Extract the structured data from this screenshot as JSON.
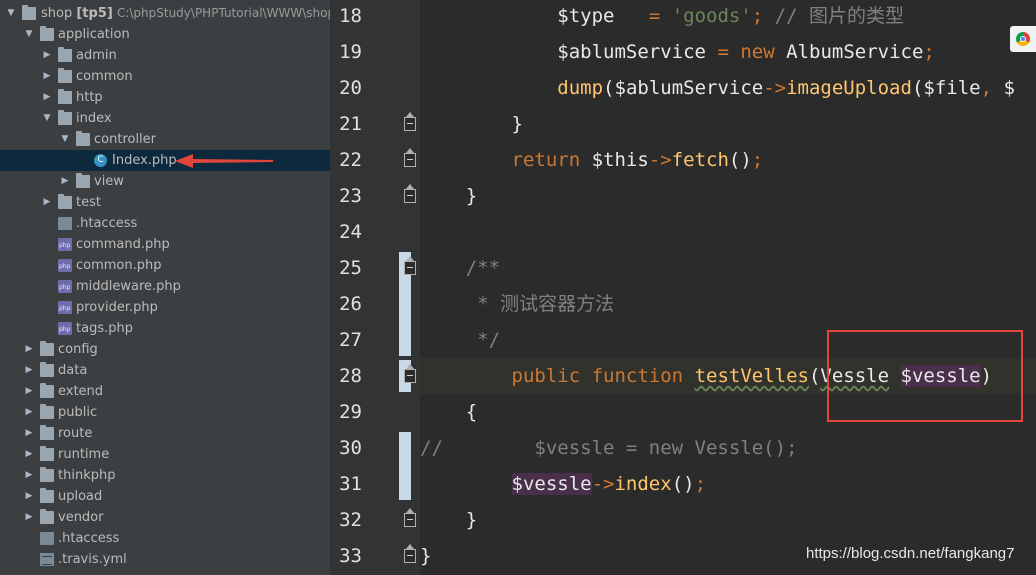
{
  "tree": {
    "root": {
      "name": "shop",
      "module": "[tp5]",
      "path": "C:\\phpStudy\\PHPTutorial\\WWW\\shop"
    },
    "items": [
      {
        "label": "application",
        "type": "folder",
        "indent": 1,
        "expanded": true
      },
      {
        "label": "admin",
        "type": "folder",
        "indent": 2,
        "expanded": false
      },
      {
        "label": "common",
        "type": "folder",
        "indent": 2,
        "expanded": false
      },
      {
        "label": "http",
        "type": "folder",
        "indent": 2,
        "expanded": false
      },
      {
        "label": "index",
        "type": "folder",
        "indent": 2,
        "expanded": true
      },
      {
        "label": "controller",
        "type": "folder",
        "indent": 3,
        "expanded": true
      },
      {
        "label": "Index.php",
        "type": "class",
        "indent": 4,
        "selected": true
      },
      {
        "label": "view",
        "type": "folder",
        "indent": 3,
        "expanded": false
      },
      {
        "label": "test",
        "type": "folder",
        "indent": 2,
        "expanded": false
      },
      {
        "label": ".htaccess",
        "type": "file",
        "indent": 2
      },
      {
        "label": "command.php",
        "type": "php",
        "indent": 2
      },
      {
        "label": "common.php",
        "type": "php",
        "indent": 2
      },
      {
        "label": "middleware.php",
        "type": "php",
        "indent": 2
      },
      {
        "label": "provider.php",
        "type": "php",
        "indent": 2
      },
      {
        "label": "tags.php",
        "type": "php",
        "indent": 2
      },
      {
        "label": "config",
        "type": "folder",
        "indent": 1,
        "expanded": false
      },
      {
        "label": "data",
        "type": "folder",
        "indent": 1,
        "expanded": false
      },
      {
        "label": "extend",
        "type": "folder",
        "indent": 1,
        "expanded": false
      },
      {
        "label": "public",
        "type": "folder",
        "indent": 1,
        "expanded": false
      },
      {
        "label": "route",
        "type": "folder",
        "indent": 1,
        "expanded": false
      },
      {
        "label": "runtime",
        "type": "folder",
        "indent": 1,
        "expanded": false
      },
      {
        "label": "thinkphp",
        "type": "folder",
        "indent": 1,
        "expanded": false
      },
      {
        "label": "upload",
        "type": "folder",
        "indent": 1,
        "expanded": false
      },
      {
        "label": "vendor",
        "type": "folder",
        "indent": 1,
        "expanded": false
      },
      {
        "label": ".htaccess",
        "type": "file",
        "indent": 1
      },
      {
        "label": ".travis.yml",
        "type": "yml",
        "indent": 1
      }
    ]
  },
  "editor": {
    "lines": [
      {
        "num": "18",
        "tokens": [
          [
            "var",
            "            $type"
          ],
          [
            "",
            "   "
          ],
          [
            "kw",
            "="
          ],
          [
            "",
            " "
          ],
          [
            "str",
            "'goods'"
          ],
          [
            "kw",
            ";"
          ],
          [
            "cm",
            " // 图片的类型"
          ]
        ]
      },
      {
        "num": "19",
        "tokens": [
          [
            "var",
            "            $ablumService"
          ],
          [
            "",
            " "
          ],
          [
            "kw",
            "="
          ],
          [
            "",
            " "
          ],
          [
            "kw",
            "new"
          ],
          [
            "",
            " "
          ],
          [
            "cls",
            "AlbumService"
          ],
          [
            "kw",
            ";"
          ]
        ]
      },
      {
        "num": "20",
        "tokens": [
          [
            "",
            "            "
          ],
          [
            "fn",
            "dump"
          ],
          [
            "",
            "("
          ],
          [
            "var",
            "$ablumService"
          ],
          [
            "kw",
            "->"
          ],
          [
            "fn",
            "imageUpload"
          ],
          [
            "",
            "("
          ],
          [
            "var",
            "$file"
          ],
          [
            "kw",
            ","
          ],
          [
            "",
            " $"
          ]
        ]
      },
      {
        "num": "21",
        "tokens": [
          [
            "",
            "        }"
          ]
        ]
      },
      {
        "num": "22",
        "tokens": [
          [
            "",
            "        "
          ],
          [
            "kw",
            "return"
          ],
          [
            "",
            " "
          ],
          [
            "var",
            "$this"
          ],
          [
            "kw",
            "->"
          ],
          [
            "fn",
            "fetch"
          ],
          [
            "",
            "()"
          ],
          [
            "kw",
            ";"
          ]
        ]
      },
      {
        "num": "23",
        "tokens": [
          [
            "",
            "    }"
          ]
        ]
      },
      {
        "num": "24",
        "tokens": []
      },
      {
        "num": "25",
        "tokens": [
          [
            "cm",
            "    /**"
          ]
        ]
      },
      {
        "num": "26",
        "tokens": [
          [
            "cm",
            "     * 测试容器方法"
          ]
        ]
      },
      {
        "num": "27",
        "tokens": [
          [
            "cm",
            "     */"
          ]
        ]
      },
      {
        "num": "28",
        "tokens": [
          [
            "",
            "        "
          ],
          [
            "kw",
            "public"
          ],
          [
            "",
            " "
          ],
          [
            "kw",
            "function"
          ],
          [
            "",
            " "
          ],
          [
            "fn",
            "testVelles"
          ],
          [
            "",
            "("
          ],
          [
            "cls",
            "Vessle"
          ],
          [
            "",
            " "
          ],
          [
            "hlvar",
            "$vessle"
          ],
          [
            "",
            ")"
          ]
        ]
      },
      {
        "num": "29",
        "tokens": [
          [
            "",
            "    {"
          ]
        ]
      },
      {
        "num": "30",
        "tokens": [
          [
            "cm",
            "//        $vessle = new Vessle();"
          ]
        ]
      },
      {
        "num": "31",
        "tokens": [
          [
            "",
            "        "
          ],
          [
            "hlvar",
            "$vessle"
          ],
          [
            "kw",
            "->"
          ],
          [
            "fn",
            "index"
          ],
          [
            "",
            "()"
          ],
          [
            "kw",
            ";"
          ]
        ]
      },
      {
        "num": "32",
        "tokens": [
          [
            "",
            "    }"
          ]
        ]
      },
      {
        "num": "33",
        "tokens": [
          [
            "",
            "}"
          ]
        ]
      }
    ],
    "current_line": "28"
  },
  "watermark": "https://blog.csdn.net/fangkang7",
  "colors": {
    "keyword": "#cc7832",
    "string": "#6a8759",
    "comment": "#808080",
    "function": "#ffc66d",
    "annotation_red": "#e0463c"
  }
}
